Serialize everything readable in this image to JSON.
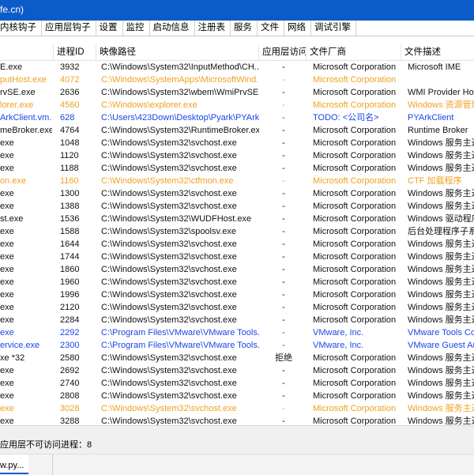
{
  "window": {
    "title": "fe.cn)"
  },
  "menu": [
    "内核钩子",
    "应用层钩子",
    "设置",
    "监控",
    "启动信息",
    "注册表",
    "服务",
    "文件",
    "网络",
    "调试引擎"
  ],
  "columns": [
    "",
    "进程ID",
    "映像路径",
    "应用层访问",
    "文件厂商",
    "文件描述"
  ],
  "rows": [
    {
      "name": "E.exe",
      "pid": "3932",
      "path": "C:\\Windows\\System32\\InputMethod\\CH...",
      "access": "-",
      "vendor": "Microsoft Corporation",
      "desc": "Microsoft IME",
      "color": "black"
    },
    {
      "name": "putHost.exe",
      "pid": "4072",
      "path": "C:\\Windows\\SystemApps\\MicrosoftWind...",
      "access": "-",
      "vendor": "Microsoft Corporation",
      "desc": "",
      "color": "orange"
    },
    {
      "name": "rvSE.exe",
      "pid": "2636",
      "path": "C:\\Windows\\System32\\wbem\\WmiPrvSE....",
      "access": "-",
      "vendor": "Microsoft Corporation",
      "desc": "WMI Provider Hos",
      "color": "black"
    },
    {
      "name": "lorer.exe",
      "pid": "4560",
      "path": "C:\\Windows\\explorer.exe",
      "access": "-",
      "vendor": "Microsoft Corporation",
      "desc": "Windows 资源管理器",
      "color": "orange"
    },
    {
      "name": "ArkClient.vm...",
      "pid": "628",
      "path": "C:\\Users\\423Down\\Desktop\\Pyark\\PYArk...",
      "access": "-",
      "vendor": "TODO: <公司名>",
      "desc": "PYArkClient",
      "color": "blue"
    },
    {
      "name": "meBroker.exe",
      "pid": "4764",
      "path": "C:\\Windows\\System32\\RuntimeBroker.exe",
      "access": "-",
      "vendor": "Microsoft Corporation",
      "desc": "Runtime Broker",
      "color": "black"
    },
    {
      "name": "exe",
      "pid": "1048",
      "path": "C:\\Windows\\System32\\svchost.exe",
      "access": "-",
      "vendor": "Microsoft Corporation",
      "desc": "Windows 服务主进程",
      "color": "black"
    },
    {
      "name": "exe",
      "pid": "1120",
      "path": "C:\\Windows\\System32\\svchost.exe",
      "access": "-",
      "vendor": "Microsoft Corporation",
      "desc": "Windows 服务主进程",
      "color": "black"
    },
    {
      "name": "exe",
      "pid": "1188",
      "path": "C:\\Windows\\System32\\svchost.exe",
      "access": "-",
      "vendor": "Microsoft Corporation",
      "desc": "Windows 服务主进程",
      "color": "black"
    },
    {
      "name": "on.exe",
      "pid": "1160",
      "path": "C:\\Windows\\System32\\ctfmon.exe",
      "access": "-",
      "vendor": "Microsoft Corporation",
      "desc": "CTF 加载程序",
      "color": "orange"
    },
    {
      "name": "exe",
      "pid": "1300",
      "path": "C:\\Windows\\System32\\svchost.exe",
      "access": "-",
      "vendor": "Microsoft Corporation",
      "desc": "Windows 服务主进程",
      "color": "black"
    },
    {
      "name": "exe",
      "pid": "1388",
      "path": "C:\\Windows\\System32\\svchost.exe",
      "access": "-",
      "vendor": "Microsoft Corporation",
      "desc": "Windows 服务主进程",
      "color": "black"
    },
    {
      "name": "st.exe",
      "pid": "1536",
      "path": "C:\\Windows\\System32\\WUDFHost.exe",
      "access": "-",
      "vendor": "Microsoft Corporation",
      "desc": "Windows 驱动程序",
      "color": "black"
    },
    {
      "name": "exe",
      "pid": "1588",
      "path": "C:\\Windows\\System32\\spoolsv.exe",
      "access": "-",
      "vendor": "Microsoft Corporation",
      "desc": "后台处理程序子系统",
      "color": "black"
    },
    {
      "name": "exe",
      "pid": "1644",
      "path": "C:\\Windows\\System32\\svchost.exe",
      "access": "-",
      "vendor": "Microsoft Corporation",
      "desc": "Windows 服务主进程",
      "color": "black"
    },
    {
      "name": "exe",
      "pid": "1744",
      "path": "C:\\Windows\\System32\\svchost.exe",
      "access": "-",
      "vendor": "Microsoft Corporation",
      "desc": "Windows 服务主进程",
      "color": "black"
    },
    {
      "name": "exe",
      "pid": "1860",
      "path": "C:\\Windows\\System32\\svchost.exe",
      "access": "-",
      "vendor": "Microsoft Corporation",
      "desc": "Windows 服务主进程",
      "color": "black"
    },
    {
      "name": "exe",
      "pid": "1960",
      "path": "C:\\Windows\\System32\\svchost.exe",
      "access": "-",
      "vendor": "Microsoft Corporation",
      "desc": "Windows 服务主进程",
      "color": "black"
    },
    {
      "name": "exe",
      "pid": "1996",
      "path": "C:\\Windows\\System32\\svchost.exe",
      "access": "-",
      "vendor": "Microsoft Corporation",
      "desc": "Windows 服务主进程",
      "color": "black"
    },
    {
      "name": "exe",
      "pid": "2120",
      "path": "C:\\Windows\\System32\\svchost.exe",
      "access": "-",
      "vendor": "Microsoft Corporation",
      "desc": "Windows 服务主进程",
      "color": "black"
    },
    {
      "name": "exe",
      "pid": "2284",
      "path": "C:\\Windows\\System32\\svchost.exe",
      "access": "-",
      "vendor": "Microsoft Corporation",
      "desc": "Windows 服务主进程",
      "color": "black"
    },
    {
      "name": "exe",
      "pid": "2292",
      "path": "C:\\Program Files\\VMware\\VMware Tools...",
      "access": "-",
      "vendor": "VMware, Inc.",
      "desc": "VMware Tools Co",
      "color": "blue"
    },
    {
      "name": "ervice.exe",
      "pid": "2300",
      "path": "C:\\Program Files\\VMware\\VMware Tools...",
      "access": "-",
      "vendor": "VMware, Inc.",
      "desc": "VMware Guest Aut",
      "color": "blue"
    },
    {
      "name": "xe *32",
      "pid": "2580",
      "path": "C:\\Windows\\System32\\svchost.exe",
      "access": "拒绝",
      "vendor": "Microsoft Corporation",
      "desc": "Windows 服务主进程",
      "color": "black"
    },
    {
      "name": "exe",
      "pid": "2692",
      "path": "C:\\Windows\\System32\\svchost.exe",
      "access": "-",
      "vendor": "Microsoft Corporation",
      "desc": "Windows 服务主进程",
      "color": "black"
    },
    {
      "name": "exe",
      "pid": "2740",
      "path": "C:\\Windows\\System32\\svchost.exe",
      "access": "-",
      "vendor": "Microsoft Corporation",
      "desc": "Windows 服务主进程",
      "color": "black"
    },
    {
      "name": "exe",
      "pid": "2808",
      "path": "C:\\Windows\\System32\\svchost.exe",
      "access": "-",
      "vendor": "Microsoft Corporation",
      "desc": "Windows 服务主进程",
      "color": "black"
    },
    {
      "name": "exe",
      "pid": "3028",
      "path": "C:\\Windows\\System32\\svchost.exe",
      "access": "-",
      "vendor": "Microsoft Corporation",
      "desc": "Windows 服务主进程",
      "color": "orange"
    },
    {
      "name": "exe",
      "pid": "3288",
      "path": "C:\\Windows\\System32\\svchost.exe",
      "access": "-",
      "vendor": "Microsoft Corporation",
      "desc": "Windows 服务主进程",
      "color": "black"
    }
  ],
  "status": {
    "text": "应用层不可访问进程：8"
  },
  "taskbar": {
    "item": "w.py..."
  }
}
